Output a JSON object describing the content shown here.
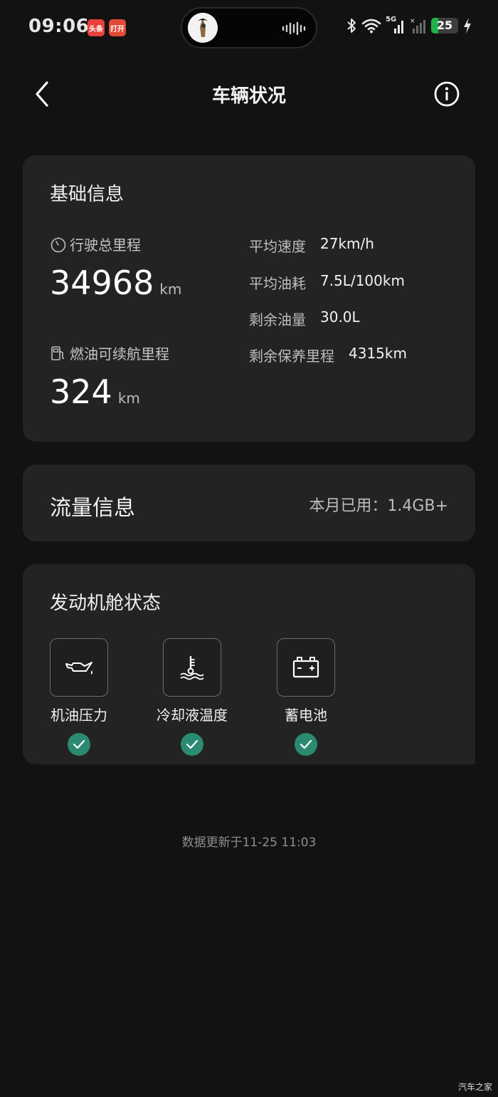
{
  "status_bar": {
    "time": "09:06",
    "app_badges": [
      "头条",
      "打开"
    ],
    "signal_label": "5G",
    "battery_level": "25",
    "battery_percent": 25
  },
  "header": {
    "title": "车辆状况",
    "back_icon": "chevron-left-icon",
    "info_icon": "info-circle-icon"
  },
  "basic_info": {
    "title": "基础信息",
    "total_mileage": {
      "label": "行驶总里程",
      "value": "34968",
      "unit": "km",
      "icon": "timer-icon"
    },
    "fuel_range": {
      "label": "燃油可续航里程",
      "value": "324",
      "unit": "km",
      "icon": "fuel-pump-icon"
    },
    "stats": [
      {
        "label": "平均速度",
        "value": "27km/h"
      },
      {
        "label": "平均油耗",
        "value": "7.5L/100km"
      },
      {
        "label": "剩余油量",
        "value": "30.0L"
      },
      {
        "label": "剩余保养里程",
        "value": "4315km"
      }
    ]
  },
  "traffic": {
    "title": "流量信息",
    "usage": "本月已用：1.4GB+"
  },
  "engine": {
    "title": "发动机舱状态",
    "items": [
      {
        "label": "机油压力",
        "icon": "oil-can-icon",
        "status": "ok"
      },
      {
        "label": "冷却液温度",
        "icon": "coolant-temp-icon",
        "status": "ok"
      },
      {
        "label": "蓄电池",
        "icon": "battery-icon",
        "status": "ok"
      }
    ]
  },
  "footer": {
    "updated": "数据更新于11-25 11:03",
    "watermark": "汽车之家"
  },
  "colors": {
    "background": "#121212",
    "card": "#232323",
    "check_ok": "#2b8a72",
    "battery_green": "#1fb24a"
  }
}
